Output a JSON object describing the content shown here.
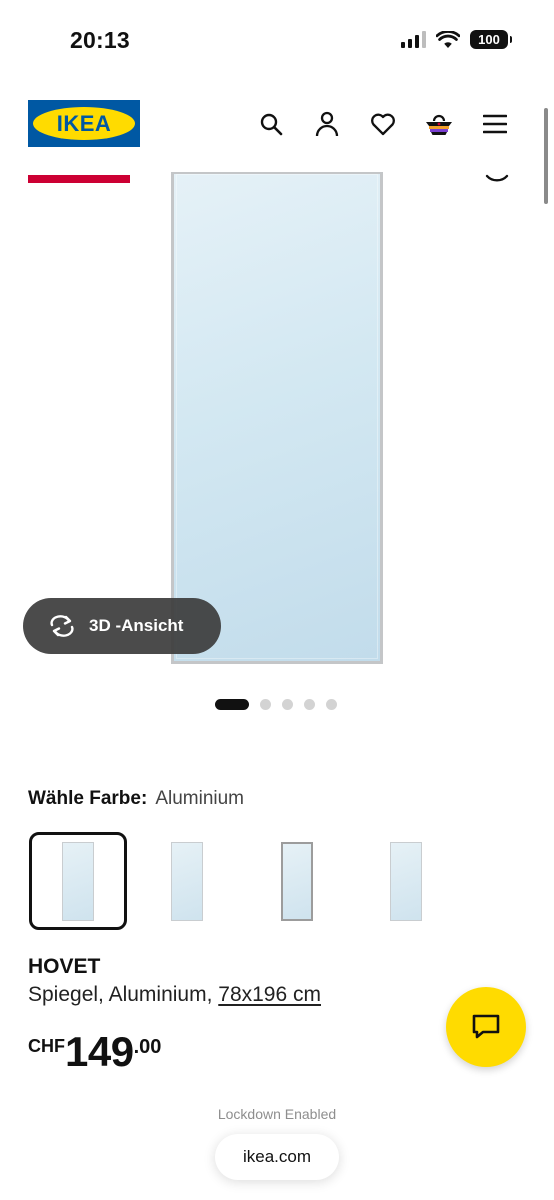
{
  "status_bar": {
    "time": "20:13",
    "battery": "100"
  },
  "header": {
    "logo_text": "IKEA",
    "brand_blue": "#0058a3",
    "brand_yellow": "#ffdb00",
    "icons": [
      "search-icon",
      "account-icon",
      "heart-icon",
      "basket-icon",
      "menu-icon"
    ]
  },
  "gallery": {
    "view_3d_label": "3D -Ansicht",
    "image_count": 5,
    "active_index": 0
  },
  "colour": {
    "label": "Wähle Farbe:",
    "value": "Aluminium",
    "option_count": 4,
    "selected_index": 0
  },
  "product": {
    "name": "HOVET",
    "description": "Spiegel, Aluminium, ",
    "size_link": "78x196 cm",
    "price_currency": "CHF",
    "price_int": "149",
    "price_dec": ".00"
  },
  "browser": {
    "lockdown_text": "Lockdown Enabled",
    "url": "ikea.com"
  },
  "colors": {
    "accent_red": "#cc0033",
    "chat_yellow": "#ffdb00"
  }
}
